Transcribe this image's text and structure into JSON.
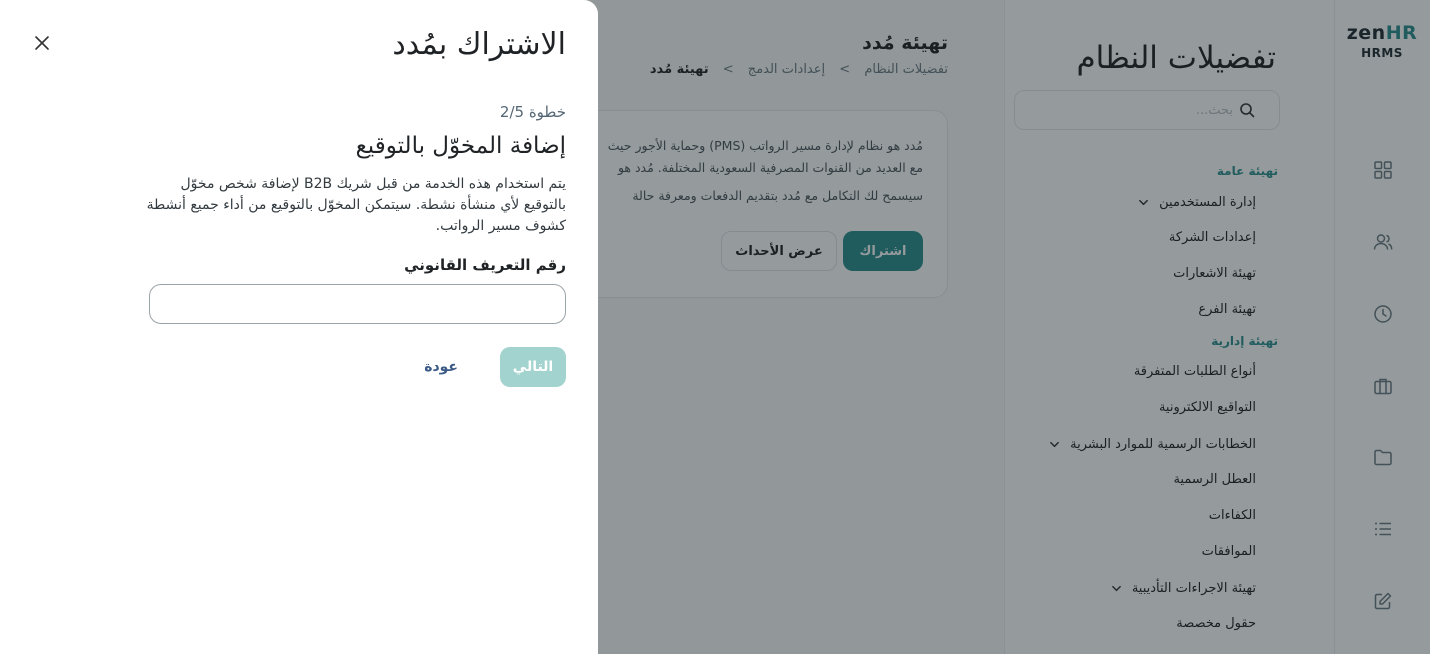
{
  "app": {
    "logo_main": "zen",
    "logo_accent": "HR",
    "logo_sub": "HRMS",
    "rail_icons": [
      "grid-icon",
      "users-icon",
      "clock-icon",
      "briefcase-icon",
      "folder-icon",
      "list-icon",
      "edit-icon"
    ]
  },
  "settings": {
    "title": "تفضيلات النظام",
    "search_placeholder": "بحث...",
    "groups": [
      {
        "label": "تهيئة عامة",
        "items": [
          {
            "label": "إدارة المستخدمين",
            "has_chevron": true
          },
          {
            "label": "إعدادات الشركة",
            "has_chevron": false
          },
          {
            "label": "تهيئة الاشعارات",
            "has_chevron": false
          },
          {
            "label": "تهيئة الفرع",
            "has_chevron": false
          }
        ]
      },
      {
        "label": "تهيئة إدارية",
        "items": [
          {
            "label": "أنواع الطلبات المتفرقة",
            "has_chevron": false
          },
          {
            "label": "التواقيع الالكترونية",
            "has_chevron": false
          },
          {
            "label": "الخطابات الرسمية للموارد البشرية",
            "has_chevron": true
          },
          {
            "label": "العطل الرسمية",
            "has_chevron": false
          },
          {
            "label": "الكفاءات",
            "has_chevron": false
          },
          {
            "label": "الموافقات",
            "has_chevron": false
          },
          {
            "label": "تهيئة الاجراءات التأديبية",
            "has_chevron": true
          },
          {
            "label": "حقول مخصصة",
            "has_chevron": false
          }
        ]
      }
    ]
  },
  "content": {
    "title": "تهيئة مُدد",
    "breadcrumb": {
      "first": "تفضيلات النظام",
      "second": "إعدادات الدمج",
      "current": "تهيئة مُدد",
      "sep": ">"
    },
    "card": {
      "line1": "مُدد هو نظام لإدارة مسير الرواتب (PMS) وحماية الأجور حيث",
      "line2": "مع العديد من القنوات المصرفية السعودية المختلفة. مُدد هو",
      "line3": "سيسمح لك التكامل مع مُدد بتقديم الدفعات ومعرفة حالة",
      "subscribe_label": "اشتراك",
      "events_label": "عرض الأحداث"
    }
  },
  "drawer": {
    "title": "الاشتراك بمُدد",
    "step": "خطوة 2/5",
    "section_title": "إضافة المخوّل بالتوقيع",
    "description": "يتم استخدام هذه الخدمة من قبل شريك B2B لإضافة شخص مخوّل بالتوقيع لأي منشأة نشطة. سيتمكن المخوّل بالتوقيع من أداء جميع أنشطة كشوف مسير الرواتب.",
    "field_label": "رقم التعريف القانوني",
    "field_value": "",
    "next_label": "التالي",
    "back_label": "عودة"
  },
  "colors": {
    "accent": "#2a8f8f",
    "next_disabled": "#a3d3cf",
    "back_link": "#3c5a86",
    "overlay": "rgba(20,30,35,0.45)"
  }
}
